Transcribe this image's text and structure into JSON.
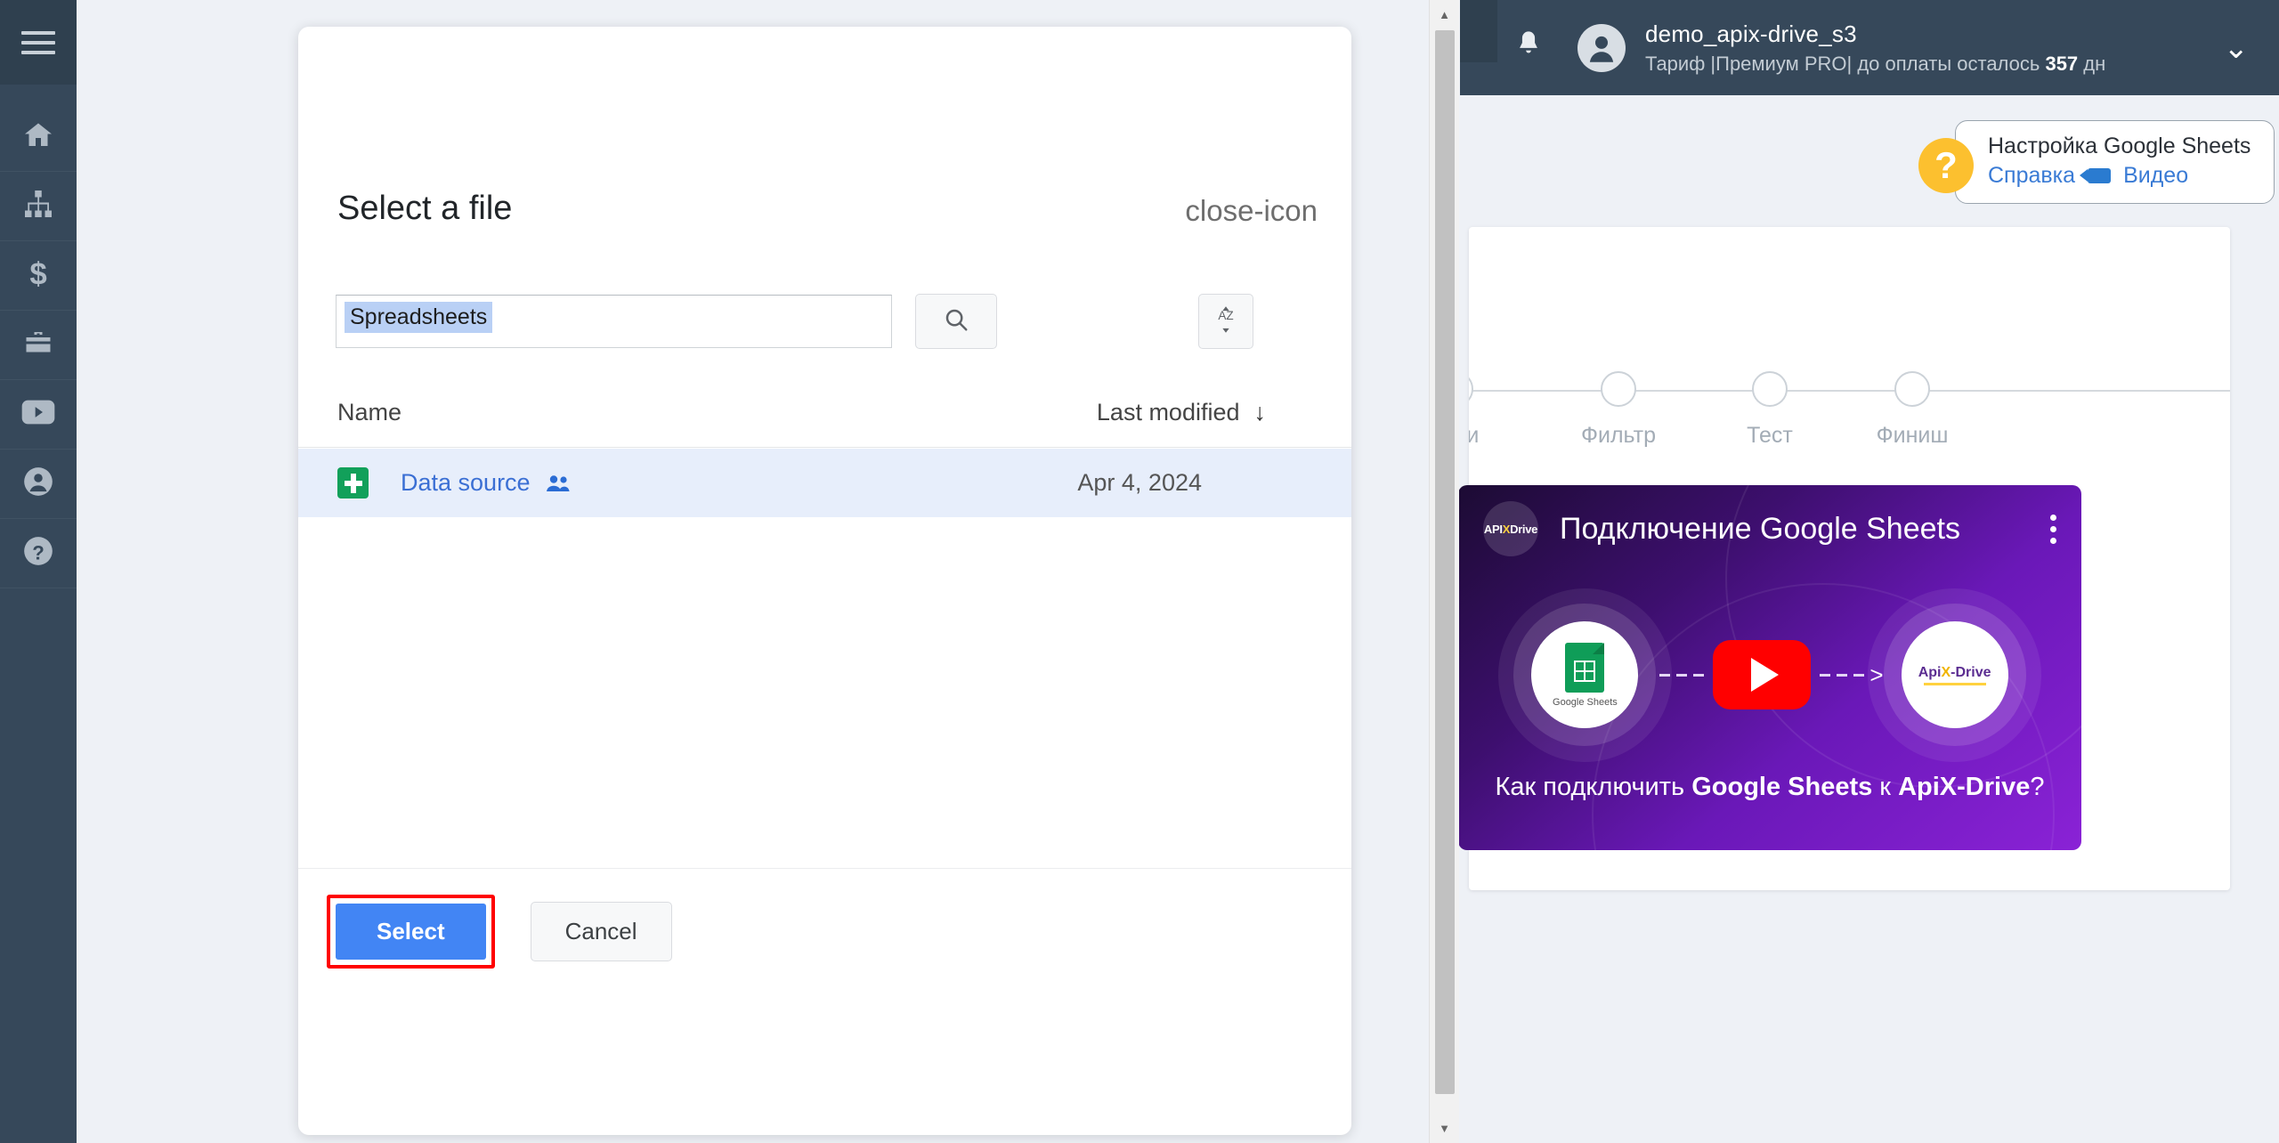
{
  "sidebar": {
    "menu_icon": "hamburger-icon",
    "items": [
      {
        "name": "home",
        "icon": "home-icon"
      },
      {
        "name": "connections",
        "icon": "sitemap-icon"
      },
      {
        "name": "billing",
        "icon": "dollar-icon"
      },
      {
        "name": "services",
        "icon": "briefcase-icon"
      },
      {
        "name": "video",
        "icon": "youtube-icon"
      },
      {
        "name": "account",
        "icon": "user-circle-icon"
      },
      {
        "name": "help",
        "icon": "question-circle-icon"
      }
    ]
  },
  "header": {
    "bell_icon": "bell-icon",
    "avatar_icon": "user-avatar-icon",
    "user_name": "demo_apix-drive_s3",
    "plan_prefix": "Тариф |Премиум PRO| до оплаты осталось ",
    "plan_days": "357",
    "plan_suffix": " дн",
    "caret_icon": "chevron-down-icon"
  },
  "help": {
    "badge": "?",
    "title": "Настройка Google Sheets",
    "link_help": "Справка",
    "link_video": "Видео",
    "video_icon": "video-camera-icon"
  },
  "stepper": {
    "steps": [
      {
        "label": "ойки"
      },
      {
        "label": "Фильтр"
      },
      {
        "label": "Тест"
      },
      {
        "label": "Финиш"
      }
    ]
  },
  "video": {
    "logo_api": "API",
    "logo_x": "X",
    "logo_drive": "Drive",
    "title": "Подключение Google Sheets",
    "menu_icon": "kebab-menu-icon",
    "left_label": "Google Sheets",
    "right_api": "Api",
    "right_x": "X",
    "right_drive": "-Drive",
    "play_icon": "play-button-icon",
    "caption_pre": "Как подключить ",
    "caption_bold1": "Google Sheets",
    "caption_mid": " к ",
    "caption_bold2": "ApiX-Drive",
    "caption_post": "?"
  },
  "modal": {
    "title": "Select a file",
    "close_icon": "close-icon",
    "search_value": "Spreadsheets",
    "search_icon": "search-icon",
    "sort_icon": "sort-az-icon",
    "columns": {
      "name": "Name",
      "last_modified": "Last modified",
      "sort_arrow": "↓"
    },
    "rows": [
      {
        "file_icon": "google-sheets-file-icon",
        "name": "Data source",
        "shared_icon": "shared-people-icon",
        "last_modified": "Apr 4, 2024"
      }
    ],
    "select_label": "Select",
    "cancel_label": "Cancel"
  },
  "colors": {
    "accent_blue": "#4285f4",
    "link_blue": "#3b6fd4",
    "highlight_red": "#ff0000",
    "sidebar_dark": "#36485a",
    "page_bg": "#eef1f6",
    "sheets_green": "#12a05a",
    "help_yellow": "#fcc02f"
  }
}
